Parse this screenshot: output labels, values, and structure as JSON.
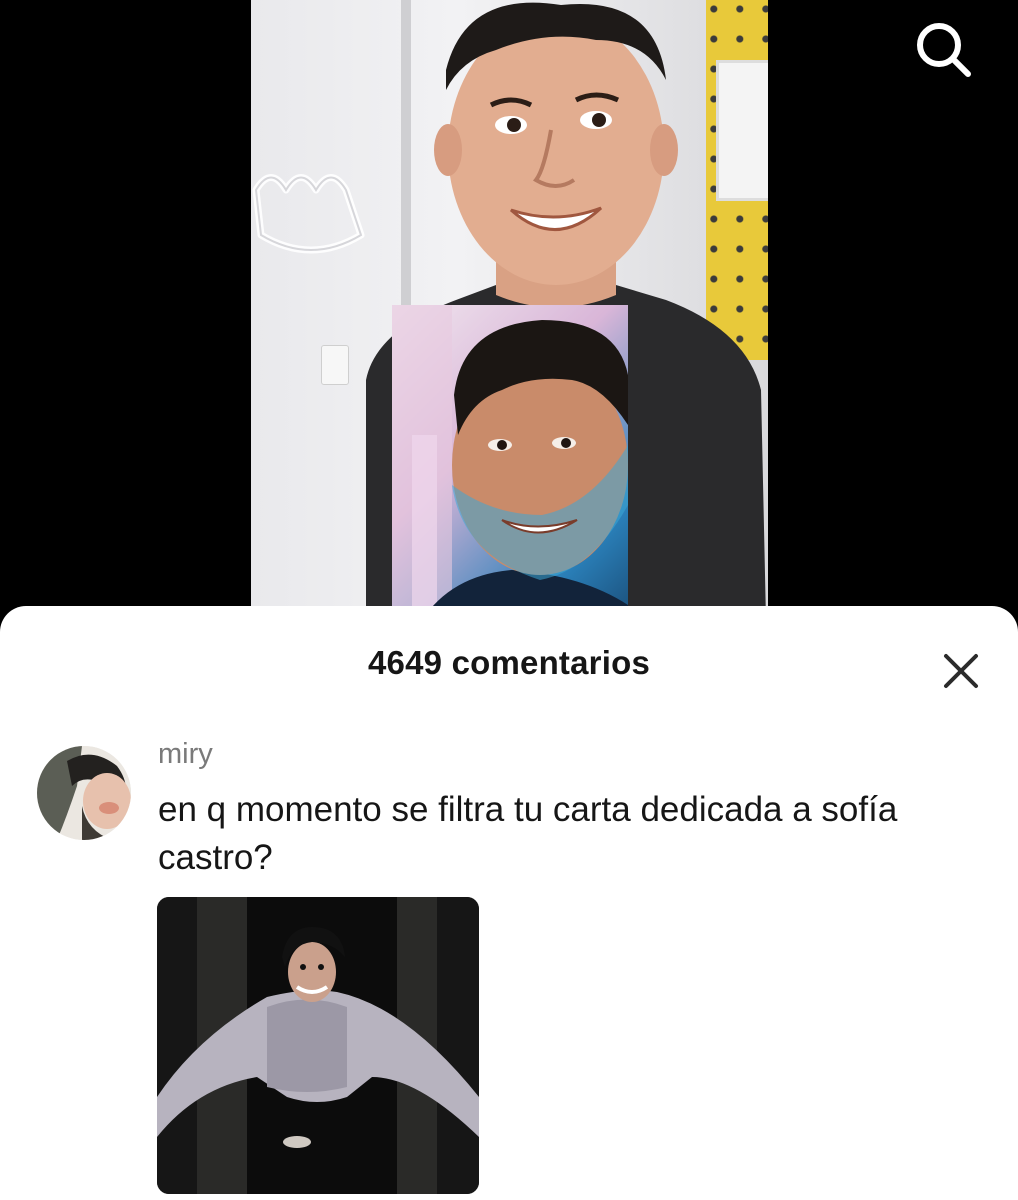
{
  "video": {
    "description_icon": "video-frame"
  },
  "top_bar": {
    "search_icon": "search-icon"
  },
  "comments_sheet": {
    "title": "4649 comentarios",
    "close_icon": "close-icon"
  },
  "comments": [
    {
      "username": "miry",
      "text": "en q momento se filtra tu carta dedicada a sofía castro?",
      "avatar_icon": "avatar",
      "attachment_icon": "meme-image"
    }
  ]
}
